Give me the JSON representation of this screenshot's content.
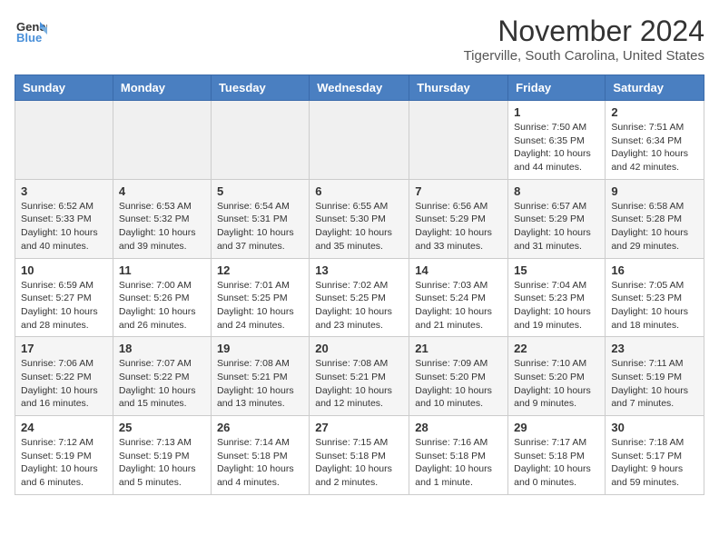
{
  "header": {
    "logo_line1": "General",
    "logo_line2": "Blue",
    "month": "November 2024",
    "location": "Tigerville, South Carolina, United States"
  },
  "days_of_week": [
    "Sunday",
    "Monday",
    "Tuesday",
    "Wednesday",
    "Thursday",
    "Friday",
    "Saturday"
  ],
  "weeks": [
    [
      {
        "day": "",
        "info": "",
        "empty": true
      },
      {
        "day": "",
        "info": "",
        "empty": true
      },
      {
        "day": "",
        "info": "",
        "empty": true
      },
      {
        "day": "",
        "info": "",
        "empty": true
      },
      {
        "day": "",
        "info": "",
        "empty": true
      },
      {
        "day": "1",
        "info": "Sunrise: 7:50 AM\nSunset: 6:35 PM\nDaylight: 10 hours\nand 44 minutes.",
        "empty": false
      },
      {
        "day": "2",
        "info": "Sunrise: 7:51 AM\nSunset: 6:34 PM\nDaylight: 10 hours\nand 42 minutes.",
        "empty": false
      }
    ],
    [
      {
        "day": "3",
        "info": "Sunrise: 6:52 AM\nSunset: 5:33 PM\nDaylight: 10 hours\nand 40 minutes.",
        "empty": false
      },
      {
        "day": "4",
        "info": "Sunrise: 6:53 AM\nSunset: 5:32 PM\nDaylight: 10 hours\nand 39 minutes.",
        "empty": false
      },
      {
        "day": "5",
        "info": "Sunrise: 6:54 AM\nSunset: 5:31 PM\nDaylight: 10 hours\nand 37 minutes.",
        "empty": false
      },
      {
        "day": "6",
        "info": "Sunrise: 6:55 AM\nSunset: 5:30 PM\nDaylight: 10 hours\nand 35 minutes.",
        "empty": false
      },
      {
        "day": "7",
        "info": "Sunrise: 6:56 AM\nSunset: 5:29 PM\nDaylight: 10 hours\nand 33 minutes.",
        "empty": false
      },
      {
        "day": "8",
        "info": "Sunrise: 6:57 AM\nSunset: 5:29 PM\nDaylight: 10 hours\nand 31 minutes.",
        "empty": false
      },
      {
        "day": "9",
        "info": "Sunrise: 6:58 AM\nSunset: 5:28 PM\nDaylight: 10 hours\nand 29 minutes.",
        "empty": false
      }
    ],
    [
      {
        "day": "10",
        "info": "Sunrise: 6:59 AM\nSunset: 5:27 PM\nDaylight: 10 hours\nand 28 minutes.",
        "empty": false
      },
      {
        "day": "11",
        "info": "Sunrise: 7:00 AM\nSunset: 5:26 PM\nDaylight: 10 hours\nand 26 minutes.",
        "empty": false
      },
      {
        "day": "12",
        "info": "Sunrise: 7:01 AM\nSunset: 5:25 PM\nDaylight: 10 hours\nand 24 minutes.",
        "empty": false
      },
      {
        "day": "13",
        "info": "Sunrise: 7:02 AM\nSunset: 5:25 PM\nDaylight: 10 hours\nand 23 minutes.",
        "empty": false
      },
      {
        "day": "14",
        "info": "Sunrise: 7:03 AM\nSunset: 5:24 PM\nDaylight: 10 hours\nand 21 minutes.",
        "empty": false
      },
      {
        "day": "15",
        "info": "Sunrise: 7:04 AM\nSunset: 5:23 PM\nDaylight: 10 hours\nand 19 minutes.",
        "empty": false
      },
      {
        "day": "16",
        "info": "Sunrise: 7:05 AM\nSunset: 5:23 PM\nDaylight: 10 hours\nand 18 minutes.",
        "empty": false
      }
    ],
    [
      {
        "day": "17",
        "info": "Sunrise: 7:06 AM\nSunset: 5:22 PM\nDaylight: 10 hours\nand 16 minutes.",
        "empty": false
      },
      {
        "day": "18",
        "info": "Sunrise: 7:07 AM\nSunset: 5:22 PM\nDaylight: 10 hours\nand 15 minutes.",
        "empty": false
      },
      {
        "day": "19",
        "info": "Sunrise: 7:08 AM\nSunset: 5:21 PM\nDaylight: 10 hours\nand 13 minutes.",
        "empty": false
      },
      {
        "day": "20",
        "info": "Sunrise: 7:08 AM\nSunset: 5:21 PM\nDaylight: 10 hours\nand 12 minutes.",
        "empty": false
      },
      {
        "day": "21",
        "info": "Sunrise: 7:09 AM\nSunset: 5:20 PM\nDaylight: 10 hours\nand 10 minutes.",
        "empty": false
      },
      {
        "day": "22",
        "info": "Sunrise: 7:10 AM\nSunset: 5:20 PM\nDaylight: 10 hours\nand 9 minutes.",
        "empty": false
      },
      {
        "day": "23",
        "info": "Sunrise: 7:11 AM\nSunset: 5:19 PM\nDaylight: 10 hours\nand 7 minutes.",
        "empty": false
      }
    ],
    [
      {
        "day": "24",
        "info": "Sunrise: 7:12 AM\nSunset: 5:19 PM\nDaylight: 10 hours\nand 6 minutes.",
        "empty": false
      },
      {
        "day": "25",
        "info": "Sunrise: 7:13 AM\nSunset: 5:19 PM\nDaylight: 10 hours\nand 5 minutes.",
        "empty": false
      },
      {
        "day": "26",
        "info": "Sunrise: 7:14 AM\nSunset: 5:18 PM\nDaylight: 10 hours\nand 4 minutes.",
        "empty": false
      },
      {
        "day": "27",
        "info": "Sunrise: 7:15 AM\nSunset: 5:18 PM\nDaylight: 10 hours\nand 2 minutes.",
        "empty": false
      },
      {
        "day": "28",
        "info": "Sunrise: 7:16 AM\nSunset: 5:18 PM\nDaylight: 10 hours\nand 1 minute.",
        "empty": false
      },
      {
        "day": "29",
        "info": "Sunrise: 7:17 AM\nSunset: 5:18 PM\nDaylight: 10 hours\nand 0 minutes.",
        "empty": false
      },
      {
        "day": "30",
        "info": "Sunrise: 7:18 AM\nSunset: 5:17 PM\nDaylight: 9 hours\nand 59 minutes.",
        "empty": false
      }
    ]
  ]
}
